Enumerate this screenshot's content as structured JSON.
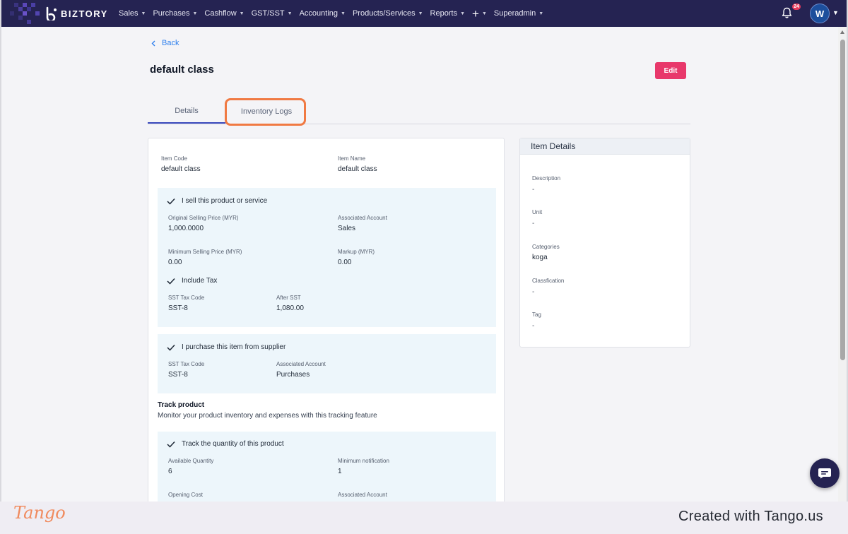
{
  "nav": {
    "brand": "BIZTORY",
    "menu": [
      {
        "label": "Sales"
      },
      {
        "label": "Purchases"
      },
      {
        "label": "Cashflow"
      },
      {
        "label": "GST/SST"
      },
      {
        "label": "Accounting"
      },
      {
        "label": "Products/Services"
      },
      {
        "label": "Reports"
      }
    ],
    "plus_label": "+",
    "superadmin": "Superadmin",
    "notification_count": "24",
    "avatar_initial": "W"
  },
  "page": {
    "back_label": "Back",
    "title": "default class",
    "edit_label": "Edit"
  },
  "tabs": [
    {
      "label": "Details"
    },
    {
      "label": "Inventory Logs"
    }
  ],
  "item": {
    "code_label": "Item Code",
    "code_value": "default class",
    "name_label": "Item Name",
    "name_value": "default class"
  },
  "sell": {
    "heading": "I sell this product or service",
    "original_price_label": "Original Selling Price (MYR)",
    "original_price_value": "1,000.0000",
    "account_label": "Associated Account",
    "account_value": "Sales",
    "min_price_label": "Minimum Selling Price (MYR)",
    "min_price_value": "0.00",
    "markup_label": "Markup (MYR)",
    "markup_value": "0.00",
    "include_tax": "Include Tax",
    "tax_code_label": "SST Tax Code",
    "tax_code_value": "SST-8",
    "after_label": "After SST",
    "after_value": "1,080.00"
  },
  "purchase": {
    "heading": "I purchase this item from supplier",
    "tax_code_label": "SST Tax Code",
    "tax_code_value": "SST-8",
    "account_label": "Associated Account",
    "account_value": "Purchases"
  },
  "track": {
    "title": "Track product",
    "description": "Monitor your product inventory and expenses with this tracking feature",
    "heading": "Track the quantity of this product",
    "qty_label": "Available Quantity",
    "qty_value": "6",
    "min_notif_label": "Minimum notification",
    "min_notif_value": "1",
    "opening_cost_label": "Opening Cost",
    "account_label": "Associated Account"
  },
  "details_panel": {
    "title": "Item Details",
    "fields": [
      {
        "label": "Description",
        "value": "-"
      },
      {
        "label": "Unit",
        "value": "-"
      },
      {
        "label": "Categories",
        "value": "koga"
      },
      {
        "label": "Classfication",
        "value": "-"
      },
      {
        "label": "Tag",
        "value": "-"
      }
    ]
  },
  "footer": {
    "logo": "Tango",
    "credit": "Created with Tango.us"
  },
  "colors": {
    "nav_bg": "#252352",
    "accent_pink": "#e8386b",
    "link_blue": "#2f80ed",
    "highlight_orange": "#f07a43",
    "section_bg": "#edf6fb"
  }
}
